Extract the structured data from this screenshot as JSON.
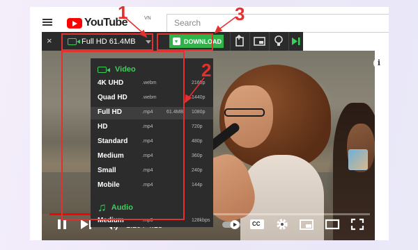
{
  "youtube": {
    "logo_text": "YouTube",
    "region": "VN",
    "search_placeholder": "Search"
  },
  "toolbar": {
    "close_icon": "×",
    "quality_label": "Full HD 61.4MB",
    "download_label": "DOWNLOAD"
  },
  "menu": {
    "video_header": "Video",
    "audio_header": "Audio",
    "video_options": [
      {
        "name": "4K UHD",
        "format": ".webm",
        "size": "",
        "resolution": "2160p"
      },
      {
        "name": "Quad HD",
        "format": ".webm",
        "size": "",
        "resolution": "1440p"
      },
      {
        "name": "Full HD",
        "format": ".mp4",
        "size": "61.4MB",
        "resolution": "1080p"
      },
      {
        "name": "HD",
        "format": ".mp4",
        "size": "",
        "resolution": "720p"
      },
      {
        "name": "Standard",
        "format": ".mp4",
        "size": "",
        "resolution": "480p"
      },
      {
        "name": "Medium",
        "format": ".mp4",
        "size": "",
        "resolution": "360p"
      },
      {
        "name": "Small",
        "format": ".mp4",
        "size": "",
        "resolution": "240p"
      },
      {
        "name": "Mobile",
        "format": ".mp4",
        "size": "",
        "resolution": "144p"
      }
    ],
    "audio_options": [
      {
        "name": "Medium",
        "format": ".mp3",
        "size": "",
        "resolution": "128kbps"
      }
    ],
    "selected_index": 2
  },
  "player": {
    "time": "1:29 / 4:18",
    "info_icon": "i",
    "progress_fraction": 0.345,
    "cc_label": "CC"
  },
  "annotations": {
    "label_1": "1",
    "label_2": "2",
    "label_3": "3"
  },
  "colors": {
    "accent_green": "#2fb44a",
    "annotation_red": "#e53030",
    "youtube_red": "#ff0000"
  }
}
